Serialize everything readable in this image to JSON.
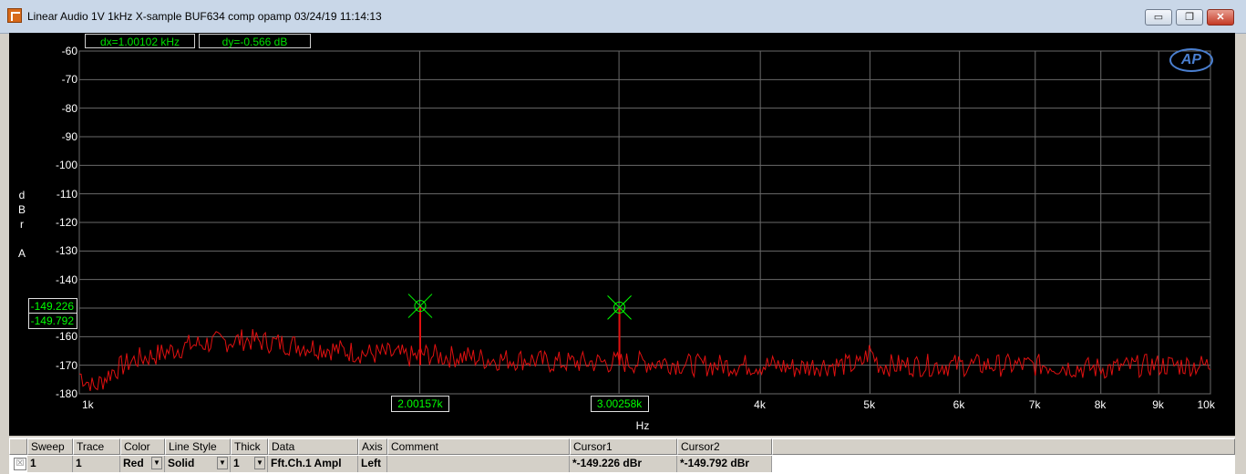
{
  "window": {
    "title": "Linear Audio  1V 1kHz X-sample BUF634 comp opamp  03/24/19 11:14:13",
    "buttons": {
      "minimize": "▭",
      "restore": "❐",
      "close": "✕"
    }
  },
  "readouts": {
    "dx": "dx=1.00102 kHz",
    "dy": "dy=-0.566  dB"
  },
  "cursors": {
    "y1_label": "-149.226",
    "y2_label": "-149.792",
    "x1_label": "2.00157k",
    "x2_label": "3.00258k"
  },
  "logo_text": "AP",
  "colors": {
    "trace": "#e01010",
    "grid": "#6a6a6a",
    "cursor": "#00ff00"
  },
  "chart_data": {
    "type": "line",
    "xlabel": "Hz",
    "ylabel_letters": [
      "d",
      "B",
      "r",
      "",
      "A"
    ],
    "x_scale": "log",
    "xlim": [
      1000,
      10000
    ],
    "ylim": [
      -180,
      -60
    ],
    "x_ticks": [
      {
        "v": 1000,
        "label": "1k"
      },
      {
        "v": 2000,
        "label": ""
      },
      {
        "v": 3000,
        "label": ""
      },
      {
        "v": 4000,
        "label": "4k"
      },
      {
        "v": 5000,
        "label": "5k"
      },
      {
        "v": 6000,
        "label": "6k"
      },
      {
        "v": 7000,
        "label": "7k"
      },
      {
        "v": 8000,
        "label": "8k"
      },
      {
        "v": 9000,
        "label": "9k"
      },
      {
        "v": 10000,
        "label": "10k"
      }
    ],
    "y_ticks": [
      {
        "v": -60,
        "label": "-60"
      },
      {
        "v": -70,
        "label": "-70"
      },
      {
        "v": -80,
        "label": "-80"
      },
      {
        "v": -90,
        "label": "-90"
      },
      {
        "v": -100,
        "label": "-100"
      },
      {
        "v": -110,
        "label": "-110"
      },
      {
        "v": -120,
        "label": "-120"
      },
      {
        "v": -130,
        "label": "-130"
      },
      {
        "v": -140,
        "label": "-140"
      },
      {
        "v": -150,
        "label": ""
      },
      {
        "v": -160,
        "label": "-160"
      },
      {
        "v": -170,
        "label": "-170"
      },
      {
        "v": -180,
        "label": "-180"
      }
    ],
    "series": [
      {
        "name": "Fft.Ch.1 Ampl",
        "x": [
          1000,
          1030,
          1070,
          1120,
          1180,
          1250,
          1320,
          1400,
          1480,
          1560,
          1640,
          1720,
          1800,
          1880,
          1950,
          1990,
          2001.57,
          2015,
          2100,
          2200,
          2300,
          2400,
          2500,
          2600,
          2700,
          2800,
          2900,
          2980,
          3002.58,
          3030,
          3150,
          3300,
          3500,
          3700,
          3900,
          4100,
          4300,
          4500,
          4700,
          4900,
          5000,
          5100,
          5400,
          5800,
          6200,
          6700,
          7200,
          7700,
          8200,
          8800,
          9400,
          10000
        ],
        "y": [
          -173,
          -178,
          -172,
          -168,
          -166,
          -163,
          -162,
          -161,
          -162,
          -163,
          -164,
          -165,
          -166,
          -166,
          -167,
          -167,
          -149.226,
          -166,
          -167,
          -167,
          -168,
          -168,
          -168,
          -169,
          -169,
          -169,
          -169,
          -169,
          -149.792,
          -169,
          -169,
          -169,
          -170,
          -170,
          -170,
          -170,
          -171,
          -170,
          -170,
          -170,
          -165,
          -170,
          -170,
          -170,
          -170,
          -170,
          -170,
          -171,
          -171,
          -170,
          -170,
          -170
        ]
      }
    ],
    "markers": [
      {
        "x": 2001.57,
        "y": -149.226
      },
      {
        "x": 3002.58,
        "y": -149.792
      }
    ]
  },
  "table": {
    "headers": [
      "Sweep",
      "Trace",
      "Color",
      "Line Style",
      "Thick",
      "Data",
      "Axis",
      "Comment",
      "Cursor1",
      "Cursor2"
    ],
    "row": [
      "1",
      "1",
      "Red",
      "Solid",
      "1",
      "Fft.Ch.1 Ampl",
      "Left",
      "",
      "*-149.226 dBr",
      "*-149.792 dBr"
    ],
    "checkbox": "☒"
  }
}
